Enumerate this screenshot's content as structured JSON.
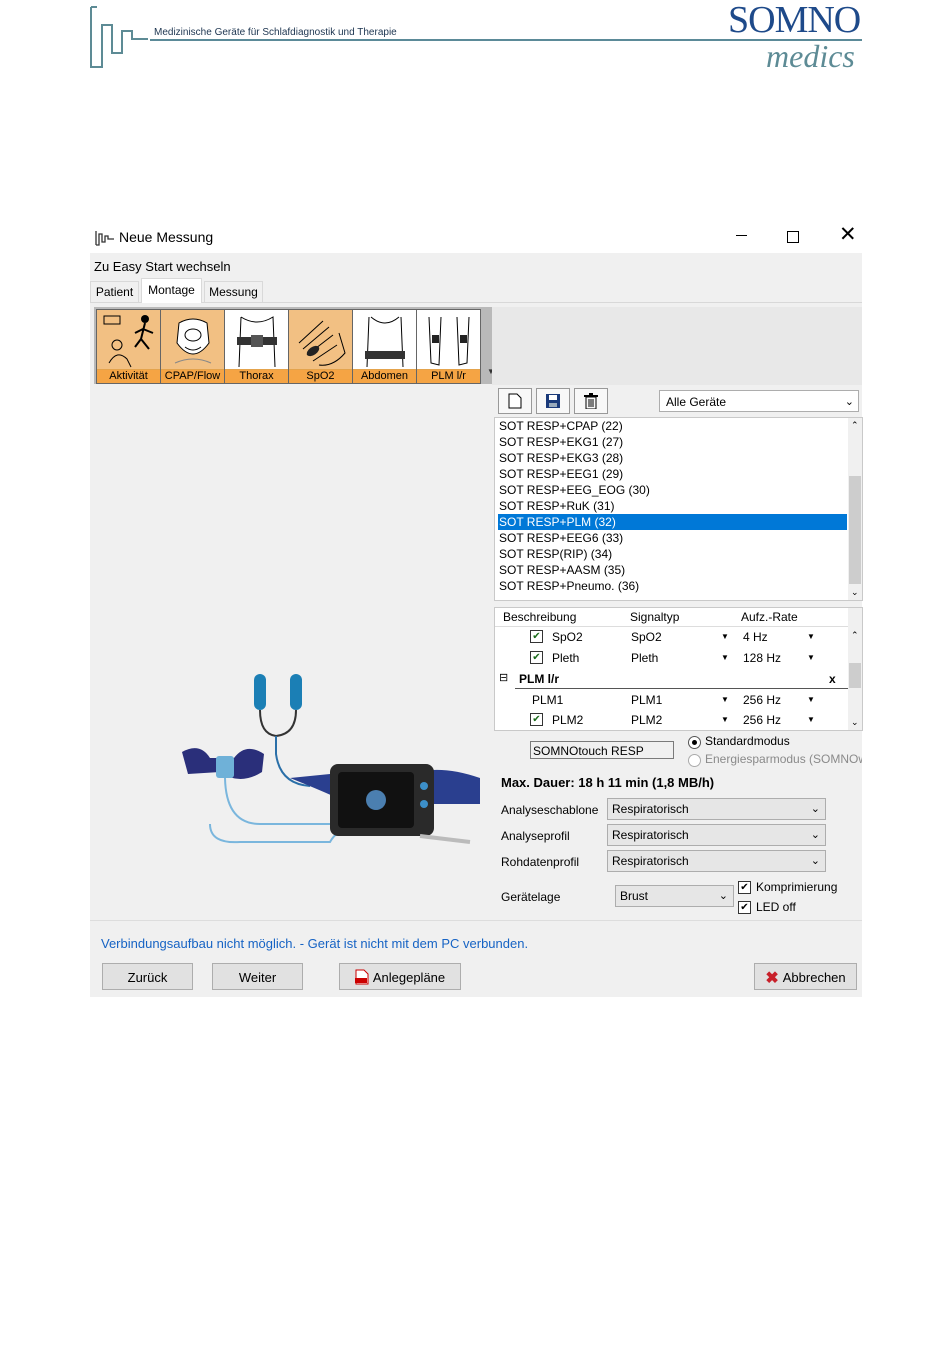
{
  "header": {
    "tagline": "Medizinische Geräte für Schlafdiagnostik und Therapie",
    "brand_top": "SOMNO",
    "brand_bottom": "medics"
  },
  "window": {
    "title": "Neue Messung",
    "easy_start_link": "Zu Easy Start wechseln",
    "tabs": [
      {
        "label": "Patient",
        "active": false
      },
      {
        "label": "Montage",
        "active": true
      },
      {
        "label": "Messung",
        "active": false
      }
    ]
  },
  "sensors": [
    {
      "label": "Aktivität",
      "icon": "activity-icon",
      "active": true
    },
    {
      "label": "CPAP/Flow",
      "icon": "cpap-mask-icon",
      "active": true
    },
    {
      "label": "Thorax",
      "icon": "thorax-belt-icon",
      "active": false
    },
    {
      "label": "SpO2",
      "icon": "spo2-hand-icon",
      "active": true
    },
    {
      "label": "Abdomen",
      "icon": "abdomen-belt-icon",
      "active": false
    },
    {
      "label": "PLM l/r",
      "icon": "plm-legs-icon",
      "active": false
    }
  ],
  "toolbar": {
    "new_icon": "new-document-icon",
    "save_icon": "save-icon",
    "delete_icon": "trash-icon",
    "device_filter": "Alle Geräte"
  },
  "montages": [
    {
      "label": "SOT RESP+CPAP (22)",
      "selected": false
    },
    {
      "label": "SOT RESP+EKG1 (27)",
      "selected": false
    },
    {
      "label": "SOT RESP+EKG3 (28)",
      "selected": false
    },
    {
      "label": "SOT RESP+EEG1 (29)",
      "selected": false
    },
    {
      "label": "SOT RESP+EEG_EOG (30)",
      "selected": false
    },
    {
      "label": "SOT RESP+RuK (31)",
      "selected": false
    },
    {
      "label": "SOT RESP+PLM (32)",
      "selected": true
    },
    {
      "label": "SOT RESP+EEG6 (33)",
      "selected": false
    },
    {
      "label": "SOT RESP(RIP) (34)",
      "selected": false
    },
    {
      "label": "SOT RESP+AASM (35)",
      "selected": false
    },
    {
      "label": "SOT RESP+Pneumo. (36)",
      "selected": false
    }
  ],
  "signal_table": {
    "headers": [
      "Beschreibung",
      "Signaltyp",
      "Aufz.-Rate"
    ],
    "rows": [
      {
        "desc": "SpO2",
        "type": "SpO2",
        "rate": "4 Hz",
        "checked": true
      },
      {
        "desc": "Pleth",
        "type": "Pleth",
        "rate": "128 Hz",
        "checked": true
      }
    ],
    "group": {
      "label": "PLM l/r",
      "collapse": "⊟",
      "remove": "x"
    },
    "group_rows": [
      {
        "desc": "PLM1",
        "type": "PLM1",
        "rate": "256 Hz",
        "checked": false
      },
      {
        "desc": "PLM2",
        "type": "PLM2",
        "rate": "256 Hz",
        "checked": true
      }
    ]
  },
  "device": {
    "name": "SOMNOtouch RESP",
    "mode_standard": "Standardmodus",
    "mode_energy": "Energiesparmodus (SOMNOw",
    "max_duration": "Max. Dauer:  18 h  11 min  (1,8 MB/h)"
  },
  "form": {
    "analysis_template_label": "Analyseschablone",
    "analysis_template_value": "Respiratorisch",
    "analysis_profile_label": "Analyseprofil",
    "analysis_profile_value": "Respiratorisch",
    "raw_profile_label": "Rohdatenprofil",
    "raw_profile_value": "Respiratorisch",
    "position_label": "Gerätelage",
    "position_value": "Brust",
    "compression_label": "Komprimierung",
    "led_label": "LED off"
  },
  "status": {
    "message": "Verbindungsaufbau nicht möglich. - Gerät ist nicht mit dem PC verbunden.",
    "color": "#1663c4"
  },
  "buttons": {
    "back": "Zurück",
    "next": "Weiter",
    "plans": "Anlegepläne",
    "cancel": "Abbrechen"
  }
}
